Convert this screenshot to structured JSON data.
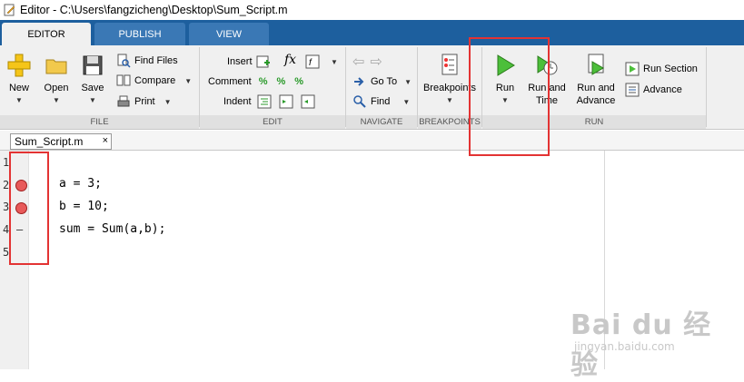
{
  "window": {
    "title": "Editor - C:\\Users\\fangzicheng\\Desktop\\Sum_Script.m"
  },
  "tabs": {
    "editor": "EDITOR",
    "publish": "PUBLISH",
    "view": "VIEW"
  },
  "file": {
    "new": "New",
    "open": "Open",
    "save": "Save",
    "find_files": "Find Files",
    "compare": "Compare",
    "print": "Print",
    "label": "FILE"
  },
  "edit": {
    "insert": "Insert",
    "comment": "Comment",
    "indent": "Indent",
    "fx": "fx",
    "label": "EDIT"
  },
  "navigate": {
    "goto": "Go To",
    "find": "Find",
    "label": "NAVIGATE"
  },
  "breakpoints": {
    "button": "Breakpoints",
    "label": "BREAKPOINTS"
  },
  "run": {
    "run": "Run",
    "run_time_1": "Run and",
    "run_time_2": "Time",
    "run_adv_1": "Run and",
    "run_adv_2": "Advance",
    "run_section": "Run Section",
    "advance": "Advance",
    "label": "RUN"
  },
  "document": {
    "tab_name": "Sum_Script.m",
    "close": "×"
  },
  "code": {
    "line_numbers": [
      "1",
      "2",
      "3",
      "4",
      "5"
    ],
    "lines": [
      "",
      "a = 3;",
      "b = 10;",
      "sum = Sum(a,b);",
      ""
    ],
    "dash": "–"
  },
  "watermark": {
    "logo": "Bai du 经验",
    "url": "jingyan.baidu.com"
  },
  "colors": {
    "ribbon_blue": "#1d5f9e",
    "breakpoint": "#e85a5a",
    "annotation_red": "#e33333"
  }
}
